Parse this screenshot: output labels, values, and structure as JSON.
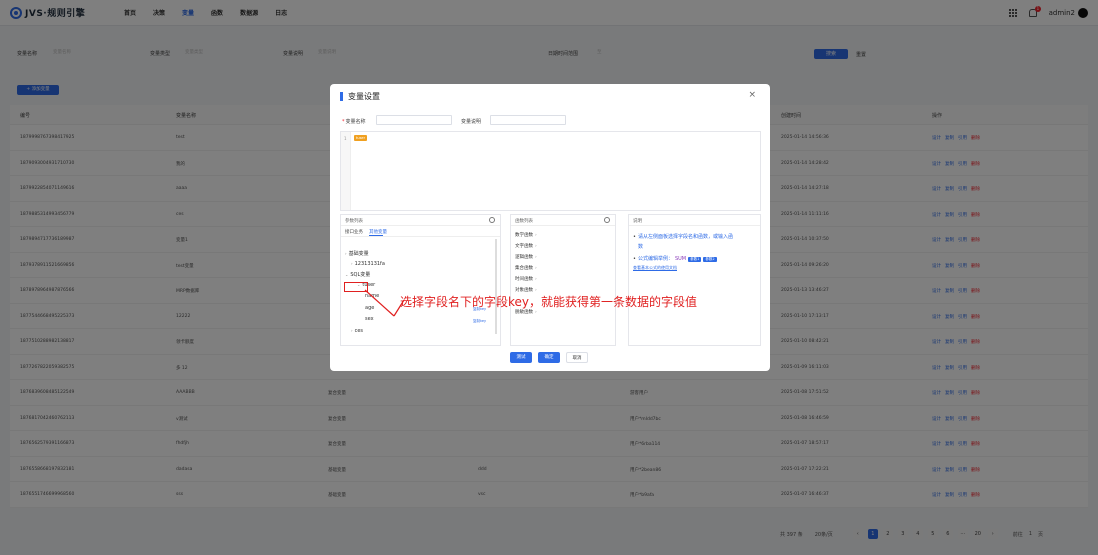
{
  "app": {
    "logo_text": "JVS·规则引擎",
    "nav": [
      "首页",
      "决策",
      "变量",
      "函数",
      "数据源",
      "日志"
    ],
    "active_nav": 2,
    "badge": "1",
    "user": "admin2"
  },
  "filters": {
    "name_label": "变量名称",
    "name_placeholder": "变量名称",
    "type_label": "变量类型",
    "type_placeholder": "变量类型",
    "desc_label": "变量说明",
    "desc_placeholder": "变量说明",
    "date_label": "日期时间范围",
    "date_placeholder": "至",
    "search": "搜索",
    "reset": "重置"
  },
  "add_button": "+ 添加变量",
  "table": {
    "headers": [
      "编号",
      "变量名称",
      "",
      "",
      "",
      "创建时间",
      "操作"
    ],
    "rows": [
      {
        "id": "1879998767398417925",
        "name": "test",
        "type": "",
        "source": "",
        "creator": "",
        "time": "2025-01-14 14:56:36"
      },
      {
        "id": "1879093004931710730",
        "name": "我的",
        "type": "",
        "source": "",
        "creator": "",
        "time": "2025-01-14 14:28:42"
      },
      {
        "id": "1879922854071149616",
        "name": "aaaa",
        "type": "",
        "source": "",
        "creator": "",
        "time": "2025-01-14 14:27:18"
      },
      {
        "id": "1879885314993456779",
        "name": "ces",
        "type": "",
        "source": "",
        "creator": "",
        "time": "2025-01-14 11:11:16"
      },
      {
        "id": "1879894717736189987",
        "name": "变量1",
        "type": "",
        "source": "",
        "creator": "",
        "time": "2025-01-14 10:37:50"
      },
      {
        "id": "1879378911521669856",
        "name": "test变量",
        "type": "",
        "source": "",
        "creator": "",
        "time": "2025-01-14 09:26:20"
      },
      {
        "id": "1878978964987876566",
        "name": "MRP数据库",
        "type": "",
        "source": "",
        "creator": "",
        "time": "2025-01-13 13:46:27"
      },
      {
        "id": "1877544668495225373",
        "name": "12222",
        "type": "",
        "source": "",
        "creator": "",
        "time": "2025-01-10 17:13:17"
      },
      {
        "id": "1877510288982138817",
        "name": "领卡额度",
        "type": "",
        "source": "",
        "creator": "",
        "time": "2025-01-10 08:42:21"
      },
      {
        "id": "1877267822059382575",
        "name": "多 12",
        "type": "",
        "source": "",
        "creator": "",
        "time": "2025-01-09 16:11:03"
      },
      {
        "id": "1876839608485122549",
        "name": "AAABBB",
        "type": "复合变量",
        "source": "",
        "creator": "游客用户",
        "time": "2025-01-08 17:51:52"
      },
      {
        "id": "1876817042460762113",
        "name": "v测试",
        "type": "复合变量",
        "source": "",
        "creator": "用户*mIdd7bc",
        "time": "2025-01-08 16:46:59"
      },
      {
        "id": "1876562579391166873",
        "name": "fhdfjh",
        "type": "复合变量",
        "source": "",
        "creator": "用户*6rba114",
        "time": "2025-01-07 18:57:17"
      },
      {
        "id": "1876558668197832181",
        "name": "dadasa",
        "type": "基础变量",
        "source": "ddd",
        "creator": "用户*2bean86",
        "time": "2025-01-07 17:22:21"
      },
      {
        "id": "1876551746699968560",
        "name": "sss",
        "type": "基础变量",
        "source": "vsc",
        "creator": "用户*b9afa",
        "time": "2025-01-07 16:46:37"
      }
    ],
    "ops": [
      "设计",
      "复制",
      "引用",
      "删除"
    ]
  },
  "pager": {
    "total": "共 397 条",
    "size": "20条/页",
    "prev": "‹",
    "pages": [
      "1",
      "2",
      "3",
      "4",
      "5",
      "6",
      "···",
      "20"
    ],
    "next": "›",
    "goto": "前往",
    "goto_value": "1",
    "goto_unit": "页"
  },
  "modal": {
    "title": "变量设置",
    "close": "×",
    "name_label": "变量名称",
    "desc_label": "变量说明",
    "editor_line": "1",
    "editor_tag": "tuser",
    "params": {
      "header": "参数列表",
      "tabs": [
        "接口业务",
        "其他变量"
      ],
      "tree": {
        "basic": "基础变量",
        "num": "12313131fa",
        "sql": "SQL变量",
        "tuser": "tuser",
        "name": "name",
        "age": "age",
        "sex": "sex",
        "ces": "ces"
      },
      "copy_key": "复制key"
    },
    "functions": {
      "header": "函数列表",
      "items": [
        "数学函数",
        "文字函数",
        "逻辑函数",
        "集合函数",
        "时间函数",
        "对象函数",
        "",
        "脱敏函数"
      ]
    },
    "notes": {
      "header": "说明",
      "line1": "请从左侧面板选择字段名和函数，或输入函",
      "line1b": "数",
      "line2": "公式编辑举例：",
      "code": "SUM",
      "tag1": "参数1",
      "tag2": "参数2",
      "link": "查看基本公式的使用文档"
    },
    "buttons": {
      "test": "测试",
      "confirm": "确定",
      "cancel": "取消"
    }
  },
  "annotation": "选择字段名下的字段key，就能获得第一条数据的字段值",
  "colors": {
    "primary": "#2e6be6",
    "danger": "#f5222d",
    "annotation": "#e02020"
  }
}
